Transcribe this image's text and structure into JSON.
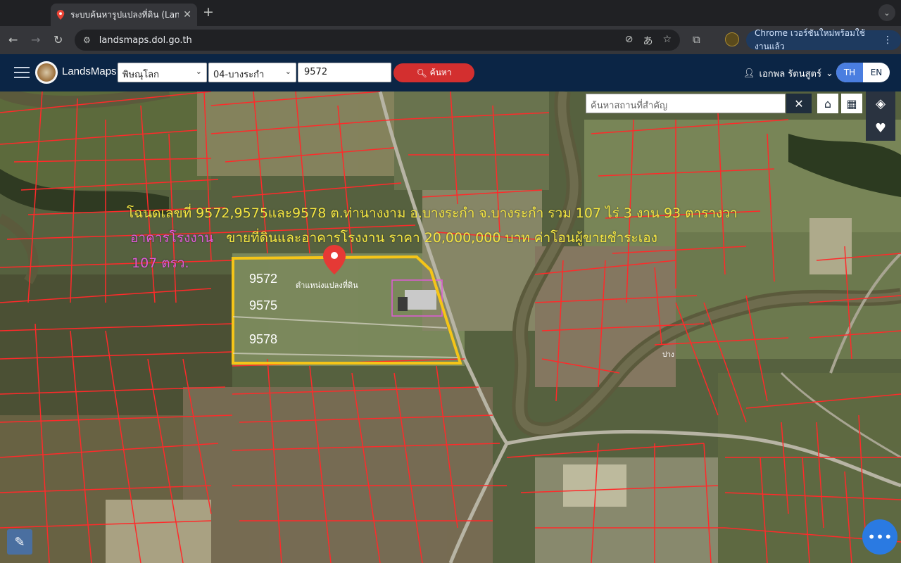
{
  "browser": {
    "tab_title": "ระบบค้นหารูปแปลงที่ดิน (LandsMaps)",
    "tab_close": "✕",
    "new_tab": "+",
    "url": "landsmaps.dol.go.th",
    "update_chip": "Chrome เวอร์ชันใหม่พร้อมใช้งานแล้ว",
    "icons": [
      "back-icon",
      "forward-icon",
      "reload-icon",
      "site-settings-icon",
      "eye-off-icon",
      "translate-icon",
      "star-icon",
      "extensions-icon"
    ]
  },
  "header": {
    "brand": "LandsMaps",
    "province": "พิษณุโลก",
    "district": "04-บางระกำ",
    "parcel_number": "9572",
    "search_label": "ค้นหา",
    "user_name": "เอกพล รัตนสูตร์",
    "lang_th": "TH",
    "lang_en": "EN"
  },
  "map": {
    "place_search_placeholder": "ค้นหาสถานที่สำคัญ",
    "overlay_line1": "โฉนดเลขที่ 9572,9575และ9578 ต.ท่านางงาม อ.บางระกำ จ.บางระกำ รวม  107 ไร่ 3 งาน 93 ตารางวา",
    "overlay_line2_magenta": "อาคารโรงงาน",
    "overlay_line2_yellow": "ขายที่ดินและอาคารโรงงาน ราคา 20,000,000 บาท ค่าโอนผู้ขายชำระเอง",
    "overlay_line3": "107 ตรว.",
    "parcels": [
      "9572",
      "9575",
      "9578"
    ],
    "pin_label": "ตำแหน่งแปลงที่ดิน",
    "river_label": "ปาง",
    "colors": {
      "boundary": "#ff2a2a",
      "selection": "#f5c518",
      "factory_box": "#e05ad8",
      "pin": "#e53935"
    }
  }
}
